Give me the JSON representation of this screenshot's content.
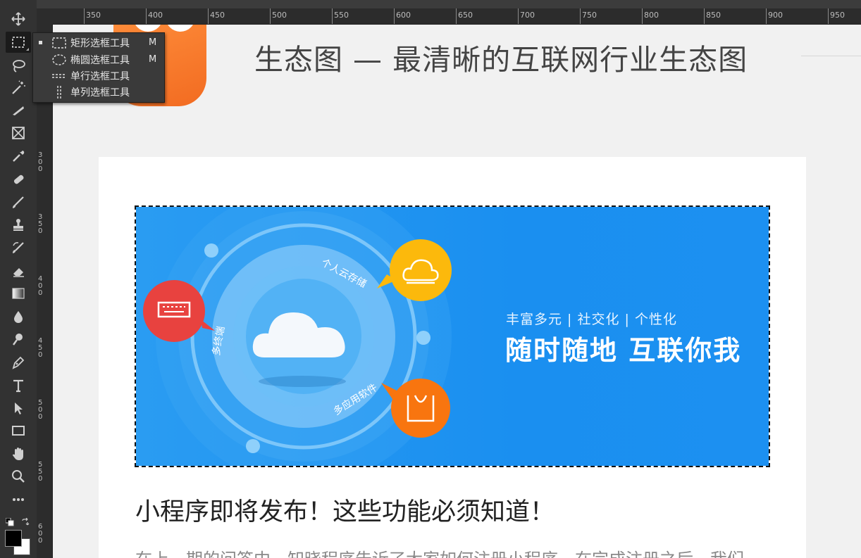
{
  "toolbar": {
    "tools": [
      "move-tool",
      "marquee-tool",
      "lasso-tool",
      "magic-wand-tool",
      "slice-tool",
      "frame-tool",
      "eyedropper-tool",
      "healing-brush-tool",
      "brush-tool",
      "stamp-tool",
      "history-brush-tool",
      "eraser-tool",
      "gradient-tool",
      "blur-tool",
      "dodge-tool",
      "pen-tool",
      "type-tool",
      "path-selection-tool",
      "rectangle-tool",
      "hand-tool",
      "zoom-tool",
      "more-tools"
    ],
    "active_tool": "marquee-tool",
    "foreground_color": "#000000",
    "background_color": "#ffffff"
  },
  "flyout": {
    "items": [
      {
        "label": "矩形选框工具",
        "shortcut": "M",
        "selected": true,
        "icon": "rect-marquee-icon"
      },
      {
        "label": "椭圆选框工具",
        "shortcut": "M",
        "selected": false,
        "icon": "ellipse-marquee-icon"
      },
      {
        "label": "单行选框工具",
        "shortcut": "",
        "selected": false,
        "icon": "single-row-marquee-icon"
      },
      {
        "label": "单列选框工具",
        "shortcut": "",
        "selected": false,
        "icon": "single-column-marquee-icon"
      }
    ]
  },
  "rulers": {
    "horizontal": [
      "350",
      "400",
      "450",
      "500",
      "550",
      "600",
      "650",
      "700",
      "750",
      "800",
      "850",
      "900",
      "950"
    ],
    "vertical": [
      "3\n0\n0",
      "3\n5\n0",
      "4\n0\n0",
      "4\n5\n0",
      "5\n0\n0",
      "5\n5\n0",
      "6\n0\n0"
    ]
  },
  "document": {
    "page_title": "生态图 — 最清晰的互联网行业生态图",
    "banner": {
      "tagline_small": "丰富多元 | 社交化 | 个性化",
      "tagline_big": "随时随地 互联你我",
      "arc_label_cloud_storage": "个人云存储",
      "arc_label_multi_device": "多终端",
      "arc_label_multi_app": "多应用软件"
    },
    "article_title": "小程序即将发布！这些功能必须知道！",
    "article_body": "在上一期的问答中，知晓程序告诉了大家如何注册小程序。在完成注册之后，我们"
  },
  "colors": {
    "accent_blue": "#1a8ff0",
    "logo_orange": "#f26b21",
    "bubble_red": "#e8423f",
    "bubble_yellow": "#fcb90c",
    "bubble_orange": "#f8750f"
  }
}
